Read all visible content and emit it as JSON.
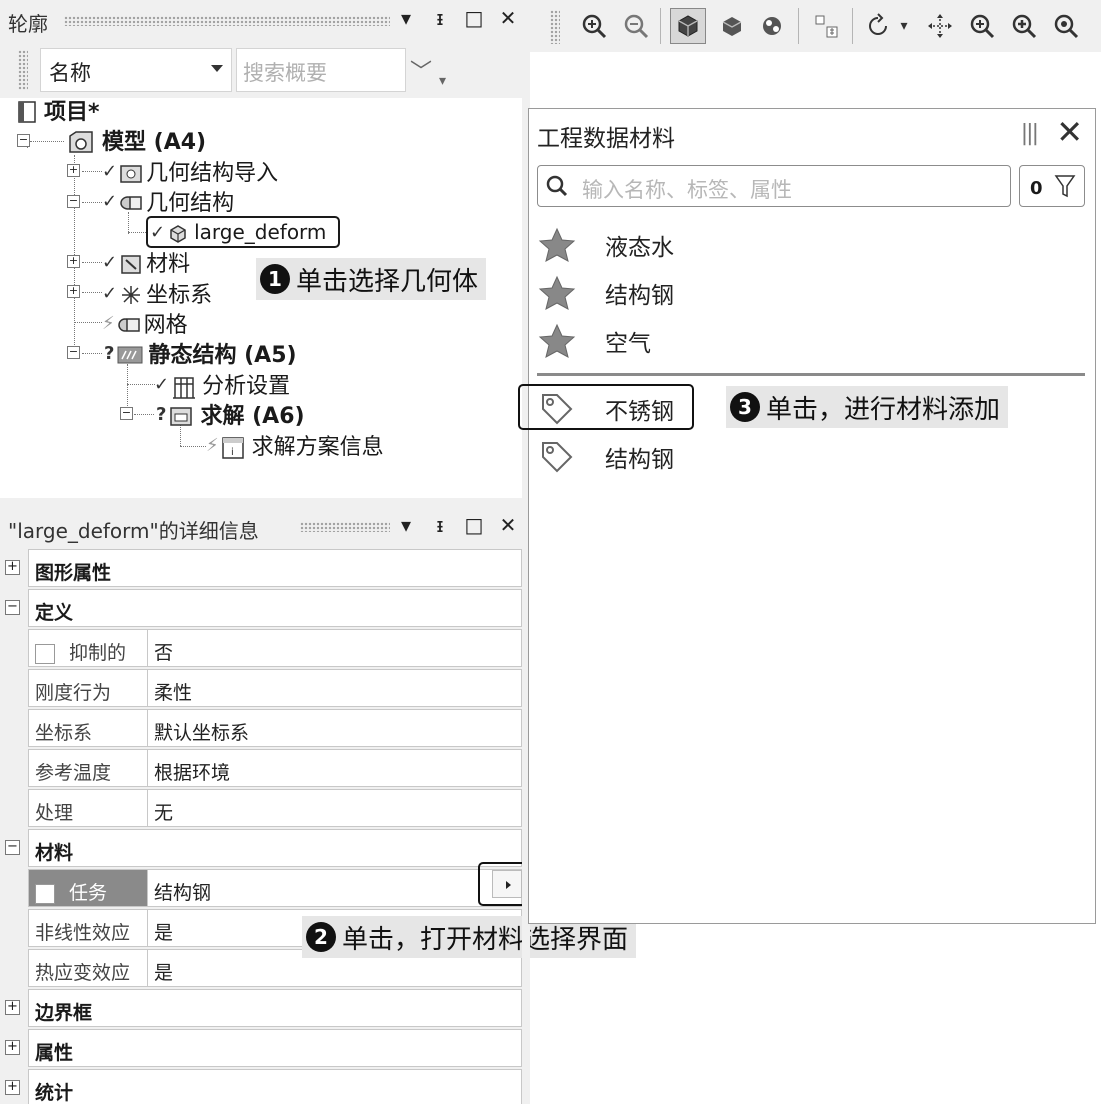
{
  "outline": {
    "title": "轮廓",
    "name_filter": "名称",
    "search_placeholder": "搜索概要",
    "search_menu": "﹀",
    "tree": {
      "project": "项目*",
      "model": "模型 (A4)",
      "geometry_import": "几何结构导入",
      "geometry": "几何结构",
      "body": "large_deform",
      "materials": "材料",
      "coordinate_systems": "坐标系",
      "mesh": "网格",
      "static_structural": "静态结构 (A5)",
      "analysis_settings": "分析设置",
      "solution": "求解 (A6)",
      "solution_information": "求解方案信息"
    }
  },
  "details": {
    "title": "\"large_deform\"的详细信息",
    "groups": {
      "graphics": "图形属性",
      "definition": "定义",
      "material": "材料",
      "bounding_box": "边界框",
      "properties": "属性",
      "statistics": "统计"
    },
    "rows": {
      "suppressed": {
        "name": "抑制的",
        "value": "否"
      },
      "stiffness": {
        "name": "刚度行为",
        "value": "柔性"
      },
      "coordinate_system": {
        "name": "坐标系",
        "value": "默认坐标系"
      },
      "reference_temperature": {
        "name": "参考温度",
        "value": "根据环境"
      },
      "treatment": {
        "name": "处理",
        "value": "无"
      },
      "assignment": {
        "name": "任务",
        "value": "结构钢"
      },
      "nonlinear_effects": {
        "name": "非线性效应",
        "value": "是"
      },
      "thermal_strain": {
        "name": "热应变效应",
        "value": "是"
      }
    }
  },
  "materials_panel": {
    "title": "工程数据材料",
    "search_placeholder": "输入名称、标签、属性",
    "filter_count": "0",
    "favorites": [
      "液态水",
      "结构钢",
      "空气"
    ],
    "library": [
      "不锈钢",
      "结构钢"
    ]
  },
  "callouts": {
    "c1_num": "1",
    "c1_text": "单击选择几何体",
    "c2_num": "2",
    "c2_text": "单击，打开材料选择界面",
    "c3_num": "3",
    "c3_text": "单击，进行材料添加"
  },
  "window_buttons": {
    "dropdown": "▾",
    "pin": "ᵻ",
    "maximize": "□",
    "close": "✕"
  },
  "colors": {
    "panel_bg": "#f0f0f0",
    "assignment_header_bg": "#8a8a8a",
    "callout_bg": "#e6e6e6"
  }
}
